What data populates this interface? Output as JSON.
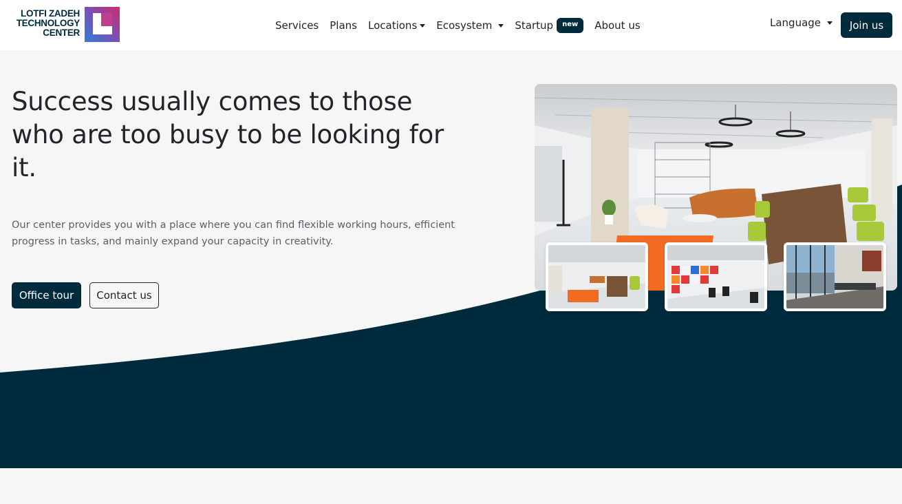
{
  "brand": {
    "line1": "LOTFI ZADEH",
    "line2": "TECHNOLOGY",
    "line3": "CENTER",
    "logo_icon": "lz-logo-mark",
    "primary_color": "#002b3d"
  },
  "nav": {
    "services": "Services",
    "plans": "Plans",
    "locations": "Locations",
    "ecosystem": "Ecosystem",
    "startup": "Startup",
    "startup_badge": "new",
    "about": "About us"
  },
  "header_actions": {
    "language": "Language",
    "join": "Join us"
  },
  "hero": {
    "headline": "Success usually comes to those who are too busy to be looking for it.",
    "description": "Our center provides you with a place where you can find flexible working hours, efficient progress in tasks, and mainly expand your capacity in creativity.",
    "primary_button": "Office tour",
    "secondary_button": "Contact us"
  },
  "colors": {
    "dark_wave": "#002b3d",
    "page_bg": "#f6f6f6",
    "accent_orange": "#f26b21",
    "accent_green": "#a8c93a"
  }
}
